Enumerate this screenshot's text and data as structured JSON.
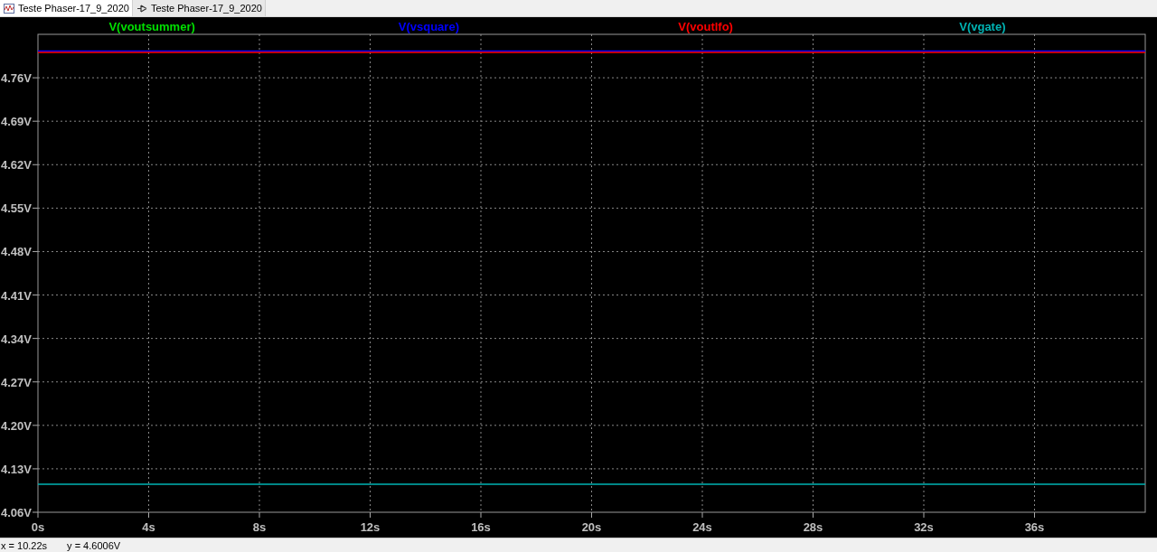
{
  "tabs": [
    {
      "label": "Teste Phaser-17_9_2020",
      "kind": "waveform",
      "selected": true
    },
    {
      "label": "Teste Phaser-17_9_2020",
      "kind": "schematic",
      "selected": false
    }
  ],
  "plot": {
    "chart_data": {
      "type": "line",
      "grid": true,
      "x": [
        0,
        40
      ],
      "xlim": [
        0,
        40
      ],
      "ylim": [
        4.06,
        4.83
      ],
      "xticks": [
        {
          "value": 0,
          "label": "0s"
        },
        {
          "value": 4,
          "label": "4s"
        },
        {
          "value": 8,
          "label": "8s"
        },
        {
          "value": 12,
          "label": "12s"
        },
        {
          "value": 16,
          "label": "16s"
        },
        {
          "value": 20,
          "label": "20s"
        },
        {
          "value": 24,
          "label": "24s"
        },
        {
          "value": 28,
          "label": "28s"
        },
        {
          "value": 32,
          "label": "32s"
        },
        {
          "value": 36,
          "label": "36s"
        }
      ],
      "yticks": [
        {
          "value": 4.06,
          "label": "4.06V"
        },
        {
          "value": 4.13,
          "label": "4.13V"
        },
        {
          "value": 4.2,
          "label": "4.20V"
        },
        {
          "value": 4.27,
          "label": "4.27V"
        },
        {
          "value": 4.34,
          "label": "4.34V"
        },
        {
          "value": 4.41,
          "label": "4.41V"
        },
        {
          "value": 4.48,
          "label": "4.48V"
        },
        {
          "value": 4.55,
          "label": "4.55V"
        },
        {
          "value": 4.62,
          "label": "4.62V"
        },
        {
          "value": 4.69,
          "label": "4.69V"
        },
        {
          "value": 4.76,
          "label": "4.76V"
        }
      ],
      "series": [
        {
          "name": "V(voutsummer)",
          "color": "#00e000",
          "values": [
            null,
            null
          ]
        },
        {
          "name": "V(vsquare)",
          "color": "#0000ff",
          "values": [
            4.803,
            4.803
          ]
        },
        {
          "name": "V(voutlfo)",
          "color": "#ff0000",
          "values": [
            4.801,
            4.801
          ]
        },
        {
          "name": "V(vgate)",
          "color": "#00b4b4",
          "values": [
            4.105,
            4.105
          ]
        }
      ]
    }
  },
  "status_bar": {
    "x_reading": "x = 10.22s",
    "y_reading": "y = 4.6006V"
  }
}
